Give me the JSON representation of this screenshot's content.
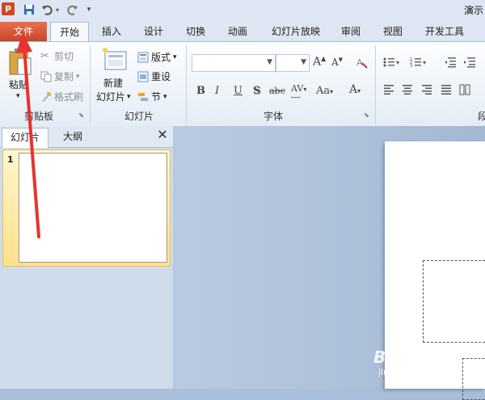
{
  "window": {
    "title": "演示",
    "app_logo": "P"
  },
  "tabs": [
    "文件",
    "开始",
    "插入",
    "设计",
    "切换",
    "动画",
    "幻灯片放映",
    "审阅",
    "视图",
    "开发工具"
  ],
  "clipboard": {
    "paste": "粘贴",
    "cut": "剪切",
    "copy": "复制",
    "format_painter": "格式刷",
    "group_label": "剪贴板"
  },
  "slides_group": {
    "new_slide_line1": "新建",
    "new_slide_line2": "幻灯片",
    "layout": "版式",
    "reset": "重设",
    "section": "节",
    "group_label": "幻灯片"
  },
  "font_group": {
    "bold": "B",
    "italic": "I",
    "underline": "U",
    "shadow": "S",
    "strike": "abc",
    "spacing": "AV",
    "case": "Aa",
    "color": "A",
    "grow": "A",
    "shrink": "A",
    "group_label": "字体"
  },
  "paragraph_group": {
    "group_label": "段"
  },
  "left_pane": {
    "tab_slides": "幻灯片",
    "tab_outline": "大纲",
    "close": "✕",
    "slide_number": "1"
  },
  "watermark": {
    "logo": "Bai 经验",
    "url": "jingyan.baidu.com"
  },
  "colors": {
    "file_tab": "#d24726",
    "annotation_arrow": "#e8322f",
    "ribbon_bg": "#e4ecf6"
  }
}
